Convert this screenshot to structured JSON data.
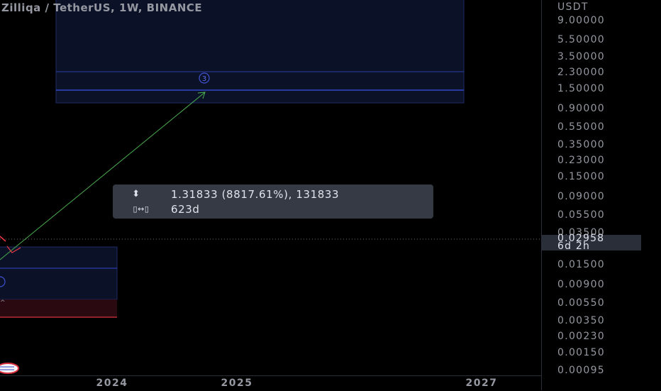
{
  "header": {
    "title": "Zilliqa / TetherUS, 1W, BINANCE"
  },
  "price_axis": {
    "unit": "USDT",
    "labels": [
      "9.00000",
      "5.50000",
      "3.50000",
      "2.30000",
      "1.50000",
      "0.90000",
      "0.55000",
      "0.35000",
      "0.23000",
      "0.15000",
      "0.09000",
      "0.05500",
      "0.03500",
      "0.01500",
      "0.00900",
      "0.00550",
      "0.00350",
      "0.00230",
      "0.00150",
      "0.00095"
    ],
    "current_price": "0.02958",
    "countdown": "6d 2h"
  },
  "time_axis": {
    "labels": [
      "2024",
      "2025",
      "2027"
    ]
  },
  "measure_tooltip": {
    "price_change": "1.31833 (8817.61%), 131833",
    "duration": "623d",
    "price_icon": "price-range-icon",
    "time_icon": "date-range-icon"
  },
  "drawings": {
    "target_marker": "3"
  },
  "colors": {
    "background": "#000000",
    "zone_fill": "#0d1530",
    "zone_line": "#2e3fa0",
    "arrow": "#4caf50",
    "loss_zone": "#3a0d12",
    "candle_red": "#f23645"
  },
  "chart_data": {
    "type": "line",
    "title": "Zilliqa / TetherUS, 1W, BINANCE",
    "yscale": "log",
    "ylabel": "USDT",
    "ylim": [
      0.00095,
      9.0
    ],
    "x_ticks": [
      "2024",
      "2025",
      "2027"
    ],
    "y_ticks": [
      9.0,
      5.5,
      3.5,
      2.3,
      1.5,
      0.9,
      0.55,
      0.35,
      0.23,
      0.15,
      0.09,
      0.055,
      0.035,
      0.015,
      0.009,
      0.0055,
      0.0035,
      0.0023,
      0.0015,
      0.00095
    ],
    "last_price": 0.02958,
    "projection": {
      "price_change": 1.31833,
      "percent_change": 8817.61,
      "ticks": 131833,
      "duration_days": 623
    }
  }
}
